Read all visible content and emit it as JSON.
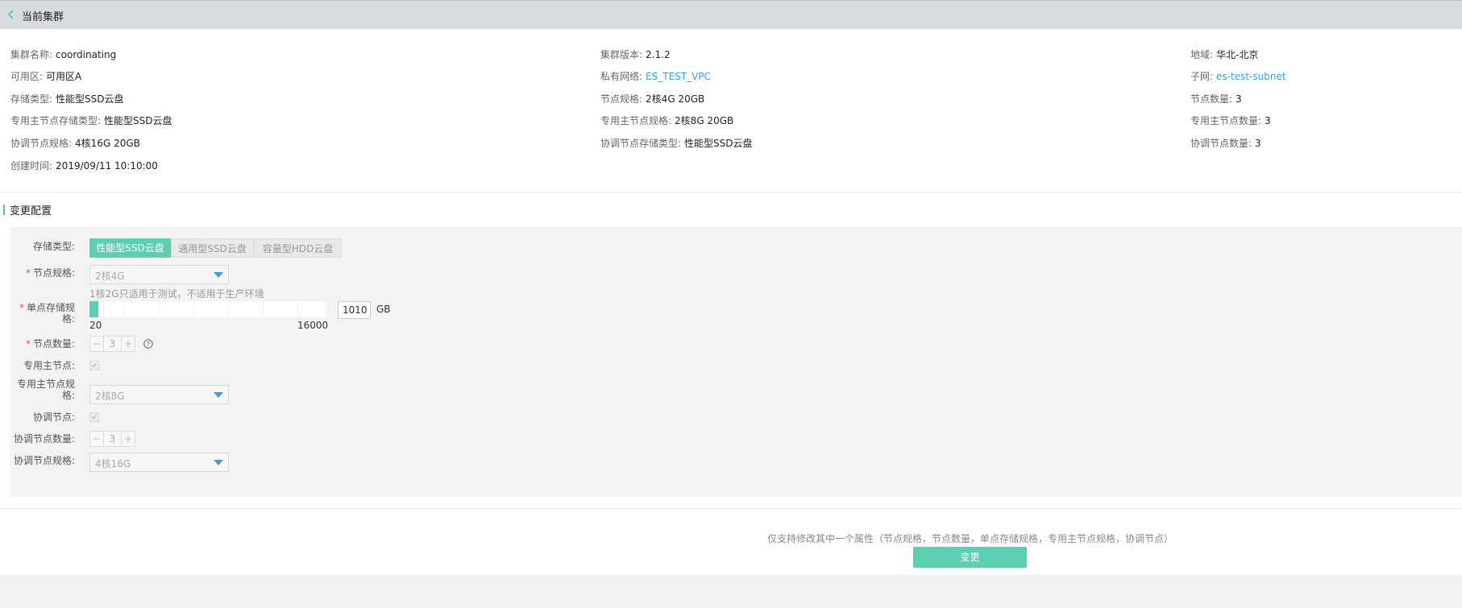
{
  "header": {
    "title": "当前集群"
  },
  "info": {
    "cluster_name": {
      "label": "集群名称:",
      "value": "coordinating"
    },
    "cluster_version": {
      "label": "集群版本:",
      "value": "2.1.2"
    },
    "region": {
      "label": "地域:",
      "value": "华北-北京"
    },
    "zone": {
      "label": "可用区:",
      "value": "可用区A"
    },
    "vpc": {
      "label": "私有网络:",
      "value": "ES_TEST_VPC"
    },
    "subnet": {
      "label": "子网:",
      "value": "es-test-subnet"
    },
    "storage_type": {
      "label": "存储类型:",
      "value": "性能型SSD云盘"
    },
    "node_spec": {
      "label": "节点规格:",
      "value": "2核4G 20GB"
    },
    "node_count": {
      "label": "节点数量:",
      "value": "3"
    },
    "master_storage_type": {
      "label": "专用主节点存储类型:",
      "value": "性能型SSD云盘"
    },
    "master_spec": {
      "label": "专用主节点规格:",
      "value": "2核8G 20GB"
    },
    "master_count": {
      "label": "专用主节点数量:",
      "value": "3"
    },
    "coord_spec": {
      "label": "协调节点规格:",
      "value": "4核16G 20GB"
    },
    "coord_storage_type": {
      "label": "协调节点存储类型:",
      "value": "性能型SSD云盘"
    },
    "coord_count": {
      "label": "协调节点数量:",
      "value": "3"
    },
    "created_time": {
      "label": "创建时间:",
      "value": "2019/09/11 10:10:00"
    }
  },
  "config": {
    "section_title": "变更配置",
    "storage_type": {
      "label": "存储类型:",
      "options": [
        "性能型SSD云盘",
        "通用型SSD云盘",
        "容量型HDD云盘"
      ],
      "selected": "性能型SSD云盘"
    },
    "node_spec": {
      "label": "节点规格:",
      "value": "2核4G",
      "hint": "1核2G只适用于测试，不适用于生产环境"
    },
    "storage_size": {
      "label": "单点存储规格:",
      "min": "20",
      "max": "16000",
      "value": "1010",
      "unit": "GB"
    },
    "node_count": {
      "label": "节点数量:",
      "value": "3"
    },
    "master_node": {
      "label": "专用主节点:",
      "checked": true
    },
    "master_spec": {
      "label": "专用主节点规格:",
      "value": "2核8G"
    },
    "coord_node": {
      "label": "协调节点:",
      "checked": true
    },
    "coord_count": {
      "label": "协调节点数量:",
      "value": "3"
    },
    "coord_spec": {
      "label": "协调节点规格:",
      "value": "4核16G"
    }
  },
  "footer": {
    "note": "仅支持修改其中一个属性（节点规格，节点数量，单点存储规格，专用主节点规格，协调节点）",
    "submit_label": "变更"
  },
  "colors": {
    "accent": "#5ccfb3",
    "link": "#3ba0d8",
    "required": "#e5533d"
  },
  "icons": [
    "chevron-left-icon",
    "chevron-down-icon",
    "minus-icon",
    "plus-icon",
    "help-icon",
    "checkbox-icon"
  ]
}
